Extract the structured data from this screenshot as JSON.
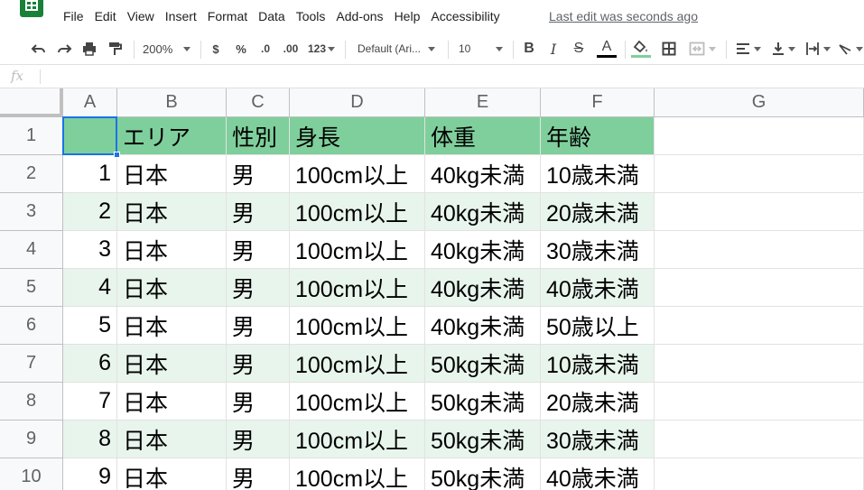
{
  "menu": {
    "items": [
      "File",
      "Edit",
      "View",
      "Insert",
      "Format",
      "Data",
      "Tools",
      "Add-ons",
      "Help",
      "Accessibility"
    ],
    "last_edit": "Last edit was seconds ago"
  },
  "toolbar": {
    "zoom": "200%",
    "currency": "$",
    "percent": "%",
    "decrease_decimal": ".0",
    "increase_decimal": ".00",
    "number_format": "123",
    "font_family": "Default (Ari...",
    "font_size": "10",
    "bold": "B",
    "italic": "I",
    "strike": "S",
    "text_color": "A"
  },
  "formula_bar": {
    "fx": "fx",
    "value": ""
  },
  "colors": {
    "header_fill": "#7fcf9c",
    "band_fill": "#e8f5ec",
    "selection": "#1a73e8"
  },
  "columns": [
    "A",
    "B",
    "C",
    "D",
    "E",
    "F",
    "G"
  ],
  "rows": [
    {
      "num": "1",
      "band": "header",
      "cells": [
        "",
        "エリア",
        "性別",
        "身長",
        "体重",
        "年齢",
        ""
      ]
    },
    {
      "num": "2",
      "band": "white",
      "cells": [
        "1",
        "日本",
        "男",
        "100cm以上",
        "40kg未満",
        "10歳未満",
        ""
      ]
    },
    {
      "num": "3",
      "band": "green",
      "cells": [
        "2",
        "日本",
        "男",
        "100cm以上",
        "40kg未満",
        "20歳未満",
        ""
      ]
    },
    {
      "num": "4",
      "band": "white",
      "cells": [
        "3",
        "日本",
        "男",
        "100cm以上",
        "40kg未満",
        "30歳未満",
        ""
      ]
    },
    {
      "num": "5",
      "band": "green",
      "cells": [
        "4",
        "日本",
        "男",
        "100cm以上",
        "40kg未満",
        "40歳未満",
        ""
      ]
    },
    {
      "num": "6",
      "band": "white",
      "cells": [
        "5",
        "日本",
        "男",
        "100cm以上",
        "40kg未満",
        "50歳以上",
        ""
      ]
    },
    {
      "num": "7",
      "band": "green",
      "cells": [
        "6",
        "日本",
        "男",
        "100cm以上",
        "50kg未満",
        "10歳未満",
        ""
      ]
    },
    {
      "num": "8",
      "band": "white",
      "cells": [
        "7",
        "日本",
        "男",
        "100cm以上",
        "50kg未満",
        "20歳未満",
        ""
      ]
    },
    {
      "num": "9",
      "band": "green",
      "cells": [
        "8",
        "日本",
        "男",
        "100cm以上",
        "50kg未満",
        "30歳未満",
        ""
      ]
    },
    {
      "num": "10",
      "band": "white",
      "cells": [
        "9",
        "日本",
        "男",
        "100cm以上",
        "50kg未満",
        "40歳未満",
        ""
      ]
    }
  ]
}
